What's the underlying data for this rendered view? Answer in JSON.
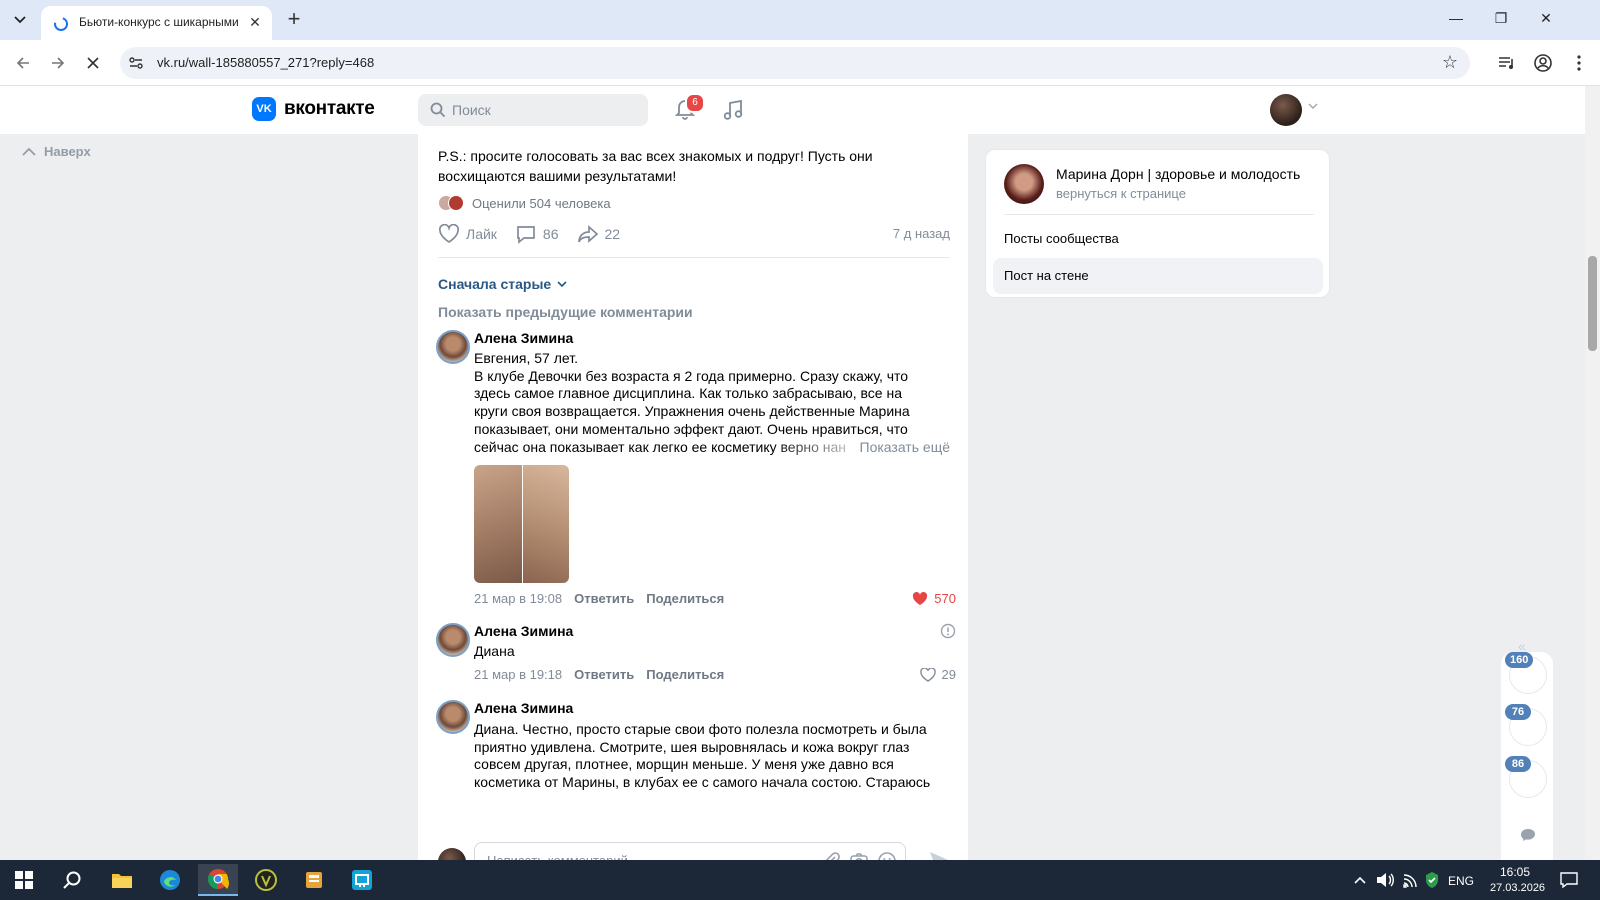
{
  "browser": {
    "tab_title": "Бьюти-конкурс с шикарными",
    "url": "vk.ru/wall-185880557_271?reply=468"
  },
  "vk": {
    "logo_text": "вконтакте",
    "search_placeholder": "Поиск",
    "notifications_count": "6",
    "back_to_top": "Наверх"
  },
  "post": {
    "ps_text": "P.S.: просите голосовать за вас всех знакомых и подруг! Пусть они восхищаются вашими результатами!",
    "rated_text": "Оценили 504 человека",
    "like_label": "Лайк",
    "comments_count": "86",
    "shares_count": "22",
    "time": "7 д назад",
    "sort_label": "Сначала старые",
    "show_previous": "Показать предыдущие комментарии"
  },
  "comments": [
    {
      "author": "Алена Зимина",
      "lines": [
        "Евгения, 57 лет.",
        "В клубе Девочки без возраста я 2 года примерно. Сразу скажу, что",
        "здесь самое главное дисциплина. Как только забрасываю, все на",
        "круги своя возвращается. Упражнения очень действенные Марина",
        "показывает, они моментально эффект дают. Очень нравиться, что",
        "сейчас она показывает как легко ее косметику верно нан"
      ],
      "show_more": "Показать ещё",
      "date": "21 мар в 19:08",
      "reply": "Ответить",
      "share": "Поделиться",
      "likes": "570"
    },
    {
      "author": "Алена Зимина",
      "lines": [
        "Диана"
      ],
      "date": "21 мар в 19:18",
      "reply": "Ответить",
      "share": "Поделиться",
      "likes": "29"
    },
    {
      "author": "Алена Зимина",
      "lines": [
        "Диана. Честно, просто старые свои фото полезла посмотреть и была",
        "приятно удивлена. Смотрите, шея выровнялась и кожа вокруг глаз",
        "совсем другая, плотнее, морщин меньше. У меня уже давно вся",
        "косметика от Марины, в клубах ее с самого начала состою. Стараюсь"
      ]
    }
  ],
  "composer": {
    "placeholder": "Написать комментарий..."
  },
  "sidebar": {
    "community_title": "Марина Дорн | здоровье и молодость",
    "back_link": "вернуться к странице",
    "items": [
      {
        "label": "Посты сообщества",
        "active": false
      },
      {
        "label": "Пост на стене",
        "active": true
      }
    ]
  },
  "float_panel": {
    "counts": [
      "160",
      "76",
      "86"
    ]
  },
  "taskbar": {
    "lang": "ENG",
    "time": "16:05",
    "date": "27.03.2026"
  },
  "colors": {
    "vk_blue": "#0077ff",
    "link": "#2a5885",
    "like_red": "#e64646",
    "taskbar": "#1c2838"
  }
}
